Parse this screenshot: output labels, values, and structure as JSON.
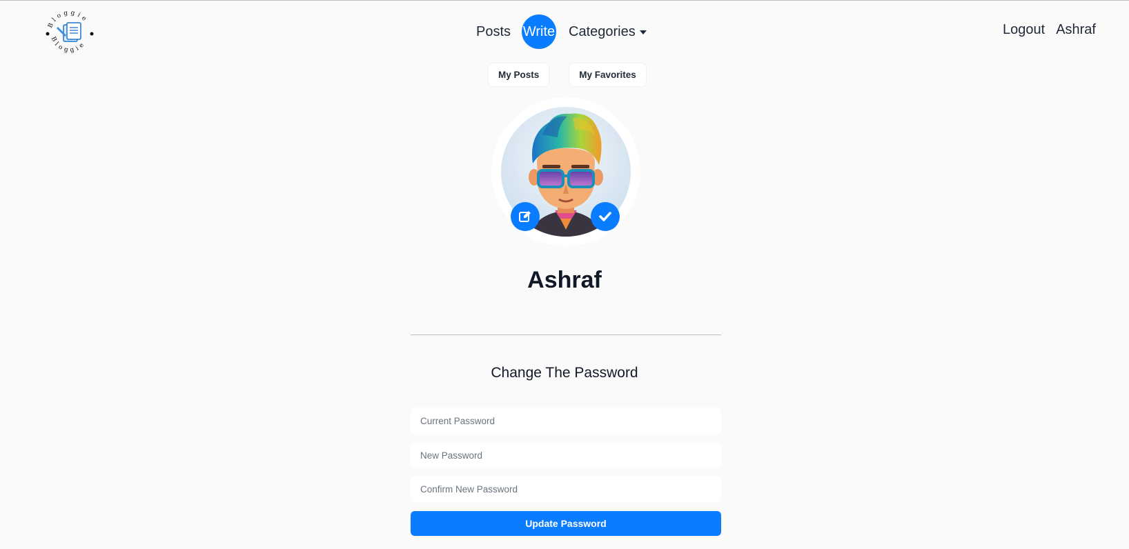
{
  "brand": {
    "logo_text": "Bloggie"
  },
  "nav": {
    "posts": "Posts",
    "write": "Write",
    "categories": "Categories",
    "logout": "Logout",
    "username": "Ashraf"
  },
  "sub_tabs": [
    {
      "label": "My Posts"
    },
    {
      "label": "My Favorites"
    }
  ],
  "profile": {
    "name": "Ashraf",
    "edit_icon": "edit-icon",
    "confirm_icon": "check-icon"
  },
  "password_form": {
    "title": "Change The Password",
    "current_placeholder": "Current Password",
    "new_placeholder": "New Password",
    "confirm_placeholder": "Confirm New Password",
    "submit_label": "Update Password"
  },
  "colors": {
    "accent": "#0a7cff",
    "background": "#fafafa"
  }
}
